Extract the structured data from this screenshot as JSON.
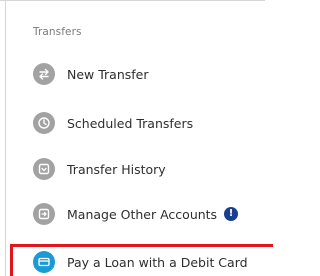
{
  "transfers_panel": {
    "section_title": "Transfers",
    "items": [
      {
        "label": "New Transfer",
        "icon": "transfer-arrows-icon"
      },
      {
        "label": "Scheduled Transfers",
        "icon": "clock-icon"
      },
      {
        "label": "Transfer History",
        "icon": "history-icon"
      },
      {
        "label": "Manage Other Accounts",
        "icon": "accounts-icon",
        "badge": "!"
      },
      {
        "label": "Pay a Loan with a Debit Card",
        "icon": "debit-card-icon",
        "highlighted": true
      }
    ]
  },
  "colors": {
    "icon_gray": "#a2a2a2",
    "icon_active": "#1a9ad6",
    "badge": "#1b3f8f",
    "highlight": "#e2141c",
    "title_text": "#7c7c7c",
    "item_text": "#2e2e2e"
  }
}
